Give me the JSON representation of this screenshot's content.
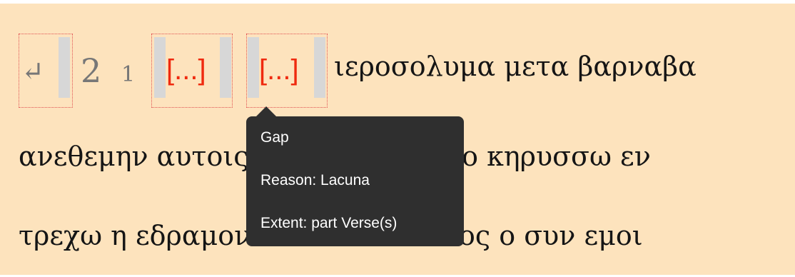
{
  "header": {
    "return_icon": "↵",
    "chapter": "2",
    "verse": "1",
    "gap1": "[...]",
    "gap2": "[...]",
    "text": "ιεροσολυμα μετα βαρναβα"
  },
  "lines": {
    "line2": "ανεθεμην αυτοις το ευαγγελιον ο κηρυσσω εν",
    "line3": "τρεχω η εδραμον 3 αλλ ουδε τιτος ο συν εμοι"
  },
  "tooltip": {
    "title": "Gap",
    "reason": "Reason: Lacuna",
    "extent": "Extent: part Verse(s)"
  },
  "colors": {
    "background": "#fde3bd",
    "gap_red": "#ef2a0f",
    "tooltip_bg": "#2f2f2f",
    "marker_grey": "#d7d7d7"
  }
}
